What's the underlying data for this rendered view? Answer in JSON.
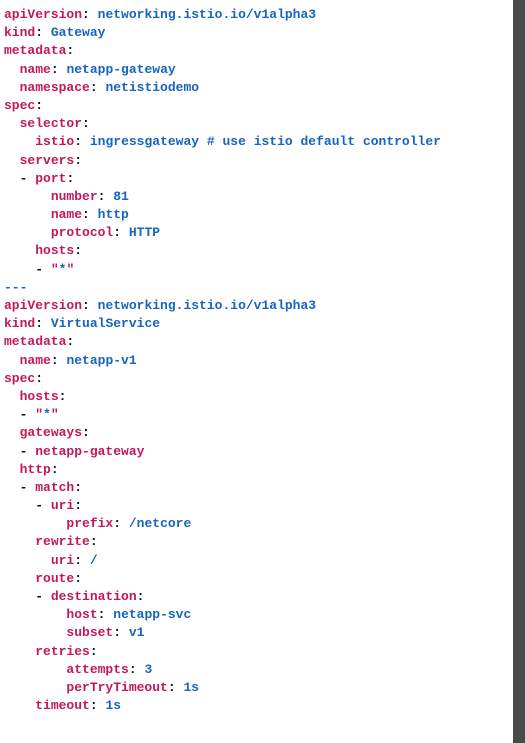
{
  "yaml": {
    "lines": [
      {
        "indent": 0,
        "key": "apiVersion",
        "val": "networking.istio.io/v1alpha3"
      },
      {
        "indent": 0,
        "key": "kind",
        "val": "Gateway"
      },
      {
        "indent": 0,
        "key": "metadata",
        "val": null
      },
      {
        "indent": 1,
        "key": "name",
        "val": "netapp-gateway"
      },
      {
        "indent": 1,
        "key": "namespace",
        "val": "netistiodemo"
      },
      {
        "indent": 0,
        "key": "spec",
        "val": null
      },
      {
        "indent": 1,
        "key": "selector",
        "val": null
      },
      {
        "indent": 2,
        "key": "istio",
        "val": "ingressgateway",
        "comment": "# use istio default controller"
      },
      {
        "indent": 1,
        "key": "servers",
        "val": null
      },
      {
        "indent": 1,
        "dash": true,
        "key": "port",
        "val": null
      },
      {
        "indent": 3,
        "key": "number",
        "val": "81"
      },
      {
        "indent": 3,
        "key": "name",
        "val": "http"
      },
      {
        "indent": 3,
        "key": "protocol",
        "val": "HTTP"
      },
      {
        "indent": 2,
        "key": "hosts",
        "val": null
      },
      {
        "indent": 2,
        "dash": true,
        "quoted": "*"
      },
      {
        "sep": "---"
      },
      {
        "indent": 0,
        "key": "apiVersion",
        "val": "networking.istio.io/v1alpha3"
      },
      {
        "indent": 0,
        "key": "kind",
        "val": "VirtualService"
      },
      {
        "indent": 0,
        "key": "metadata",
        "val": null
      },
      {
        "indent": 1,
        "key": "name",
        "val": "netapp-v1"
      },
      {
        "indent": 0,
        "key": "spec",
        "val": null
      },
      {
        "indent": 1,
        "key": "hosts",
        "val": null
      },
      {
        "indent": 1,
        "dash": true,
        "quoted": "*"
      },
      {
        "indent": 1,
        "key": "gateways",
        "val": null
      },
      {
        "indent": 1,
        "dash": true,
        "scalar": "netapp-gateway"
      },
      {
        "indent": 1,
        "key": "http",
        "val": null
      },
      {
        "indent": 1,
        "dash": true,
        "key": "match",
        "val": null
      },
      {
        "indent": 2,
        "dash": true,
        "key": "uri",
        "val": null
      },
      {
        "indent": 4,
        "key": "prefix",
        "val": "/netcore"
      },
      {
        "indent": 2,
        "key": "rewrite",
        "val": null
      },
      {
        "indent": 3,
        "key": "uri",
        "val": "/"
      },
      {
        "indent": 2,
        "key": "route",
        "val": null
      },
      {
        "indent": 2,
        "dash": true,
        "key": "destination",
        "val": null
      },
      {
        "indent": 4,
        "key": "host",
        "val": "netapp-svc"
      },
      {
        "indent": 4,
        "key": "subset",
        "val": "v1"
      },
      {
        "indent": 2,
        "key": "retries",
        "val": null
      },
      {
        "indent": 4,
        "key": "attempts",
        "val": "3"
      },
      {
        "indent": 4,
        "key": "perTryTimeout",
        "val": "1s"
      },
      {
        "indent": 2,
        "key": "timeout",
        "val": "1s"
      }
    ]
  }
}
